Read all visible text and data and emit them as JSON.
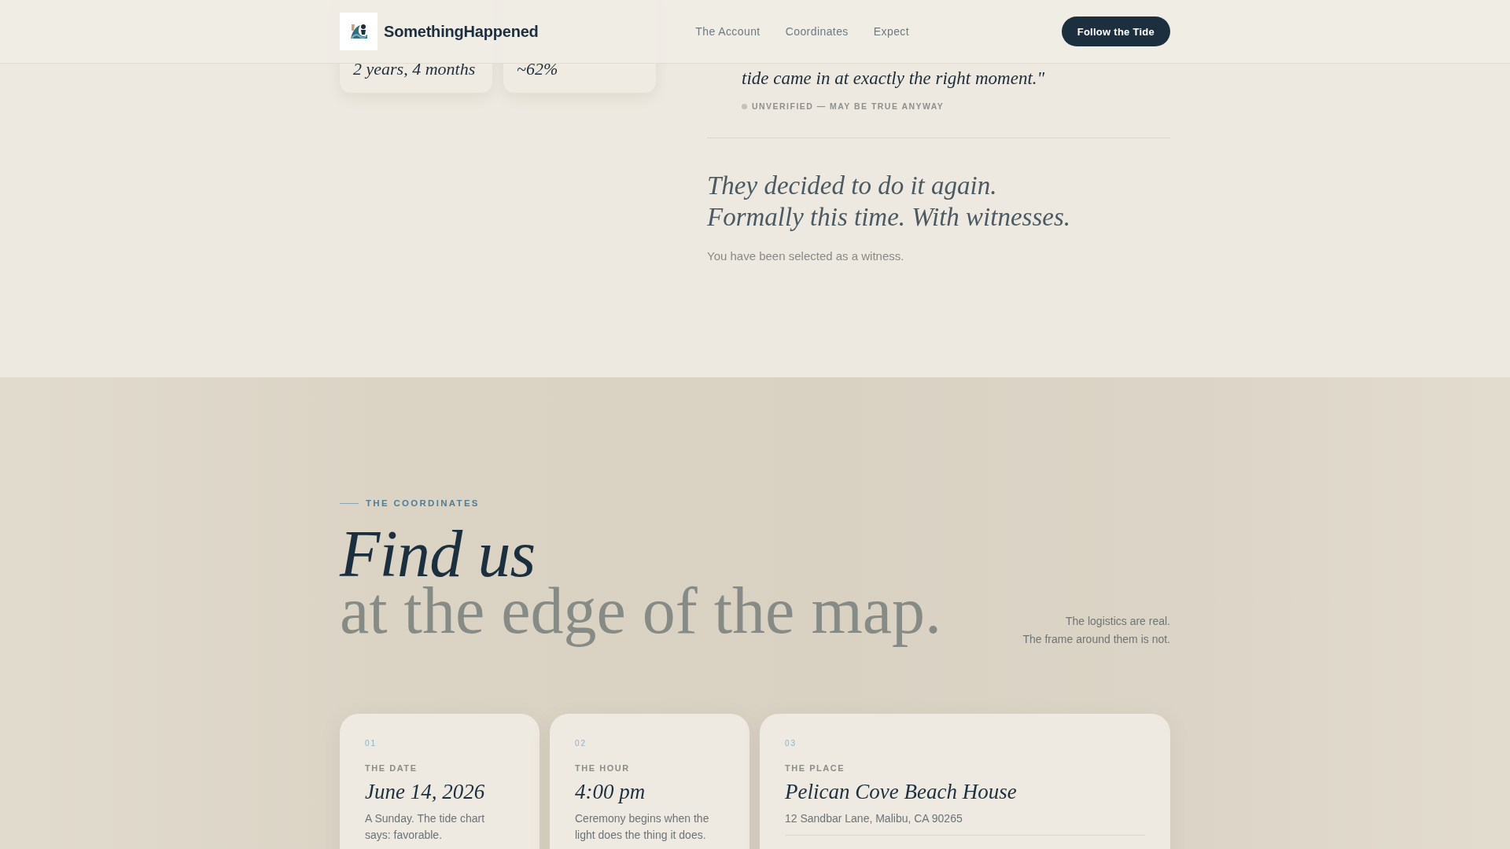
{
  "header": {
    "brand": "SomethingHappened",
    "nav": [
      {
        "label": "The Account"
      },
      {
        "label": "Coordinates"
      },
      {
        "label": "Expect"
      }
    ],
    "cta": "Follow the Tide"
  },
  "stats": [
    {
      "value": "2 years, 4 months"
    },
    {
      "value": "~62%"
    }
  ],
  "story": {
    "quote": "tide came in at exactly the right moment.\"",
    "note": "UNVERIFIED — MAY BE TRUE ANYWAY",
    "heading_lines": [
      "They decided to do it again.",
      "Formally this time. With witnesses."
    ],
    "subtext": "You have been selected as a witness."
  },
  "coordinates": {
    "eyebrow": "THE COORDINATES",
    "title": {
      "lead": "Find us",
      "rest": "at the edge of the map."
    },
    "aside": [
      "The logistics are real.",
      "The frame around them is not."
    ],
    "cards": [
      {
        "kind": "detail",
        "number": "01",
        "label": "THE DATE",
        "title": "June 14, 2026",
        "description": "A Sunday. The tide chart says: favorable."
      },
      {
        "kind": "detail",
        "number": "02",
        "label": "THE HOUR",
        "title": "4:00 pm",
        "description": "Ceremony begins when the light does the thing it does."
      },
      {
        "kind": "place",
        "number": "03",
        "label": "THE PLACE",
        "title": "Pelican Cove Beach House",
        "description": "12 Sandbar Lane, Malibu, CA 90265"
      }
    ]
  }
}
